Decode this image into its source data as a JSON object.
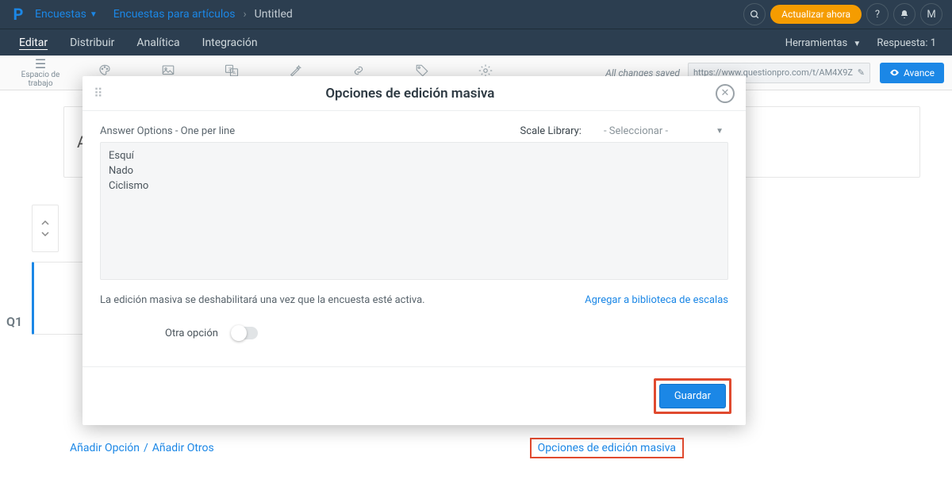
{
  "topbar": {
    "product": "Encuestas",
    "folder": "Encuestas para artículos",
    "survey": "Untitled",
    "update_btn": "Actualizar ahora",
    "avatar_letter": "M"
  },
  "tabs": {
    "edit": "Editar",
    "distribute": "Distribuir",
    "analytics": "Analítica",
    "integration": "Integración",
    "tools": "Herramientas",
    "responses_label": "Respuesta: 1"
  },
  "toolbar": {
    "workspace": "Espacio de trabajo",
    "saved": "All changes saved",
    "url": "https://www.questionpro.com/t/AM4X9Z",
    "preview": "Avance"
  },
  "editor": {
    "placeholder_letter": "A",
    "qnum": "Q1",
    "add_option": "Añadir Opción",
    "add_other": "Añadir Otros",
    "bulk_link": "Opciones de edición masiva"
  },
  "modal": {
    "title": "Opciones de edición masiva",
    "answer_label": "Answer Options - One per line",
    "scale_label": "Scale Library:",
    "scale_placeholder": "- Seleccionar -",
    "options_text": "Esquí\nNado\nCiclismo",
    "disable_note": "La edición masiva se deshabilitará una vez que la encuesta esté activa.",
    "add_library": "Agregar a biblioteca de escalas",
    "other_option": "Otra opción",
    "save": "Guardar"
  }
}
